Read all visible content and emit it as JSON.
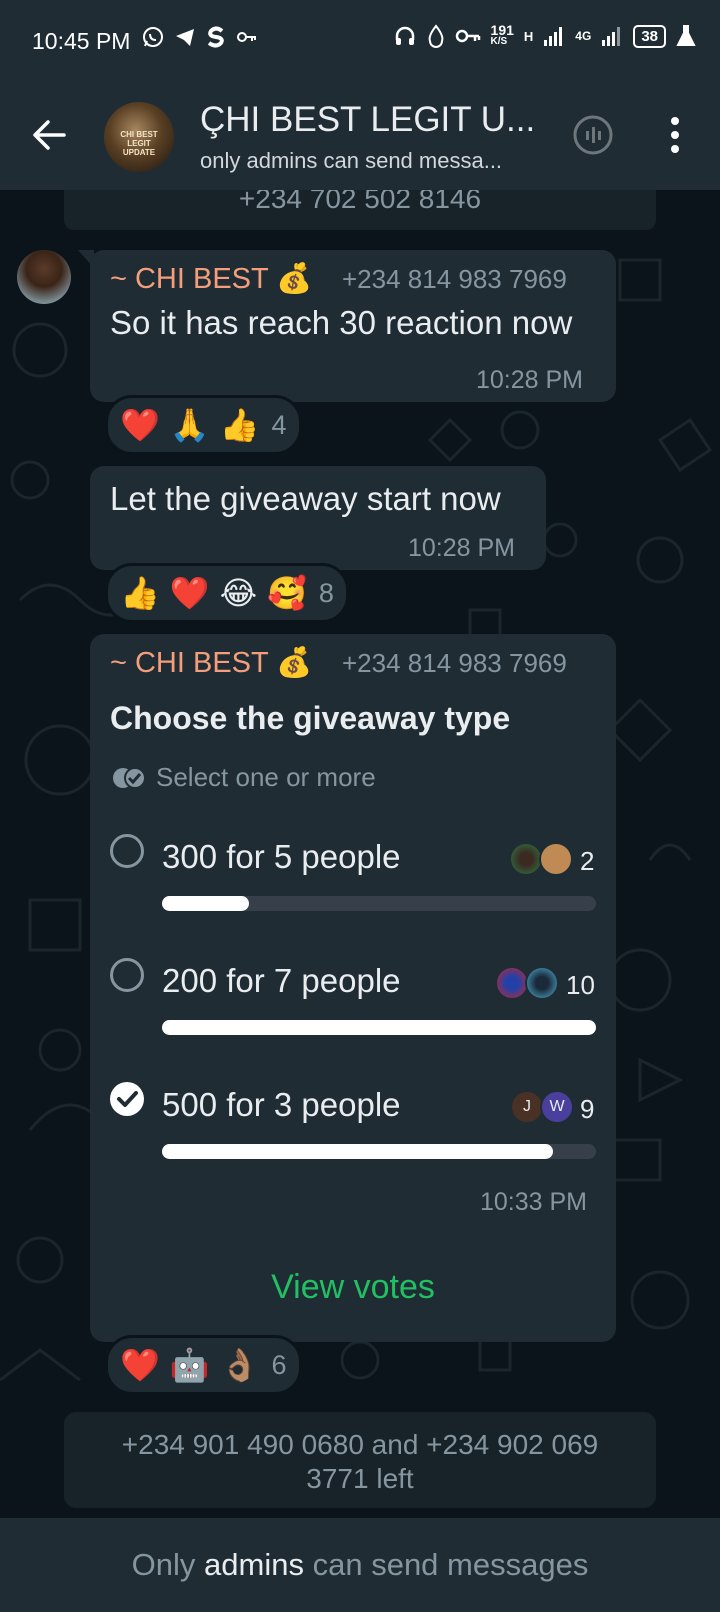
{
  "statusbar": {
    "time": "10:45 PM",
    "net_speed": "191",
    "net_unit": "K/S",
    "network_h": "H",
    "network_4g": "4G",
    "battery": "38"
  },
  "header": {
    "title": "ÇHI BEST LEGIT U...",
    "subtitle": "only admins can send messa...",
    "avatar_text": "CHI BEST LEGIT UPDATE"
  },
  "chat": {
    "cutoff_system": "+234 702 502 8146",
    "messages": [
      {
        "sender": "~ CHI BEST 💰",
        "phone": "+234 814 983 7969",
        "text": "So it has reach 30 reaction now",
        "time": "10:28 PM",
        "reactions": {
          "emojis": [
            "❤️",
            "🙏",
            "👍"
          ],
          "count": "4"
        }
      },
      {
        "text": "Let the giveaway start now",
        "time": "10:28 PM",
        "reactions": {
          "emojis": [
            "👍",
            "❤️",
            "😂",
            "🥰"
          ],
          "count": "8"
        }
      }
    ],
    "poll": {
      "sender": "~ CHI BEST 💰",
      "phone": "+234 814 983 7969",
      "question": "Choose the giveaway type",
      "hint": "Select one or more",
      "options": [
        {
          "label": "300 for 5 people",
          "votes": "2",
          "fraction": 0.2,
          "checked": false
        },
        {
          "label": "200 for 7 people",
          "votes": "10",
          "fraction": 1.0,
          "checked": false
        },
        {
          "label": "500 for 3 people",
          "votes": "9",
          "fraction": 0.9,
          "checked": true,
          "avatars": [
            "J",
            "W"
          ]
        }
      ],
      "time": "10:33 PM",
      "view_votes": "View votes",
      "reactions": {
        "emojis": [
          "❤️",
          "🤖",
          "👌🏽"
        ],
        "count": "6"
      }
    },
    "system_left": "+234 901 490 0680 and +234 902 069 3771 left"
  },
  "footer": {
    "before": "Only",
    "bold": "admins",
    "after": "can send messages"
  },
  "colors": {
    "background": "#0b141a",
    "bubble": "#1f2c34",
    "sender": "#f59e7b",
    "accent_green": "#21c063",
    "muted": "#8696a0"
  }
}
